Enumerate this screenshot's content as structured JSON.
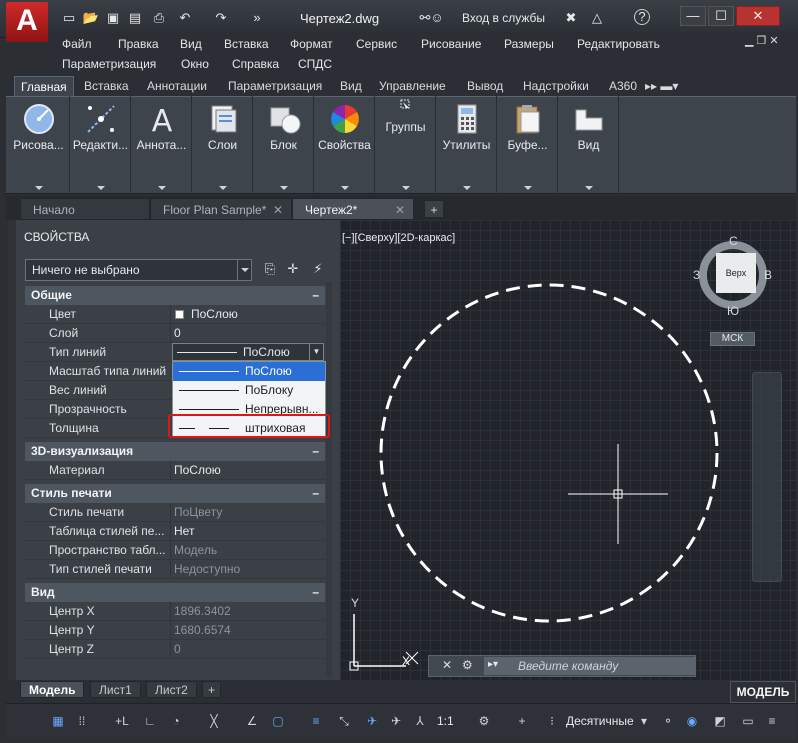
{
  "titlebar": {
    "logo": "A",
    "document_title": "Чертеж2.dwg",
    "signin": "Вход в службы",
    "win_min": "—",
    "win_max": "☐",
    "win_close": "✕"
  },
  "menu": {
    "row1": [
      "Файл",
      "Правка",
      "Вид",
      "Вставка",
      "Формат",
      "Сервис",
      "Рисование",
      "Размеры",
      "Редактировать"
    ],
    "row2": [
      "Параметризация",
      "Окно",
      "Справка",
      "СПДС"
    ]
  },
  "ribbon": {
    "tabs": [
      "Главная",
      "Вставка",
      "Аннотации",
      "Параметризация",
      "Вид",
      "Управление",
      "Вывод",
      "Надстройки",
      "A360"
    ],
    "buttons": [
      {
        "label": "Рисова...",
        "icon": "draw-icon"
      },
      {
        "label": "Редакти...",
        "icon": "modify-icon"
      },
      {
        "label": "Аннота...",
        "icon": "annotation-icon"
      },
      {
        "label": "Слои",
        "icon": "layers-icon"
      },
      {
        "label": "Блок",
        "icon": "block-icon"
      },
      {
        "label": "Свойства",
        "icon": "properties-icon"
      },
      {
        "label": "Группы",
        "icon": "groups-icon"
      },
      {
        "label": "Утилиты",
        "icon": "utilities-icon"
      },
      {
        "label": "Буфе...",
        "icon": "clipboard-icon"
      },
      {
        "label": "Вид",
        "icon": "view-icon"
      }
    ]
  },
  "file_tabs": [
    {
      "label": "Начало"
    },
    {
      "label": "Floor Plan Sample*"
    },
    {
      "label": "Чертеж2*"
    }
  ],
  "properties": {
    "title": "СВОЙСТВА",
    "selection": "Ничего не выбрано",
    "sections": {
      "general": "Общие",
      "viz3d": "3D-визуализация",
      "plotstyle": "Стиль печати",
      "view": "Вид"
    },
    "general": [
      {
        "key": "Цвет",
        "value": "ПоСлою"
      },
      {
        "key": "Слой",
        "value": "0"
      },
      {
        "key": "Тип линий",
        "value": "ПоСлою"
      },
      {
        "key": "Масштаб типа линий",
        "value": ""
      },
      {
        "key": "Вес линий",
        "value": ""
      },
      {
        "key": "Прозрачность",
        "value": ""
      },
      {
        "key": "Толщина",
        "value": ""
      }
    ],
    "viz3d": [
      {
        "key": "Материал",
        "value": "ПоСлою"
      }
    ],
    "plotstyle": [
      {
        "key": "Стиль печати",
        "value": "ПоЦвету"
      },
      {
        "key": "Таблица стилей пе...",
        "value": "Нет"
      },
      {
        "key": "Пространство  табл...",
        "value": "Модель"
      },
      {
        "key": "Тип стилей печати",
        "value": "Недоступно"
      }
    ],
    "view": [
      {
        "key": "Центр X",
        "value": "1896.3402"
      },
      {
        "key": "Центр Y",
        "value": "1680.6574"
      },
      {
        "key": "Центр Z",
        "value": "0"
      }
    ],
    "linetype_options": [
      "ПоСлою",
      "ПоБлоку",
      "Непрерывн...",
      "штриховая"
    ]
  },
  "viewport": {
    "label": "[−][Сверху][2D-каркас]",
    "viewcube": {
      "top": "Верх",
      "n": "С",
      "s": "Ю",
      "w": "З",
      "e": "В"
    },
    "ucs_name": "МСК",
    "ucs_y": "Y",
    "ucs_x": "X"
  },
  "command": {
    "placeholder": "Введите команду"
  },
  "layout_tabs": [
    "Модель",
    "Лист1",
    "Лист2"
  ],
  "status": {
    "model": "МОДЕЛЬ",
    "scale": "1:1",
    "units": "Десятичные"
  },
  "colors": {
    "accent_red": "#e0151a",
    "selection_blue": "#2a6fd6"
  }
}
